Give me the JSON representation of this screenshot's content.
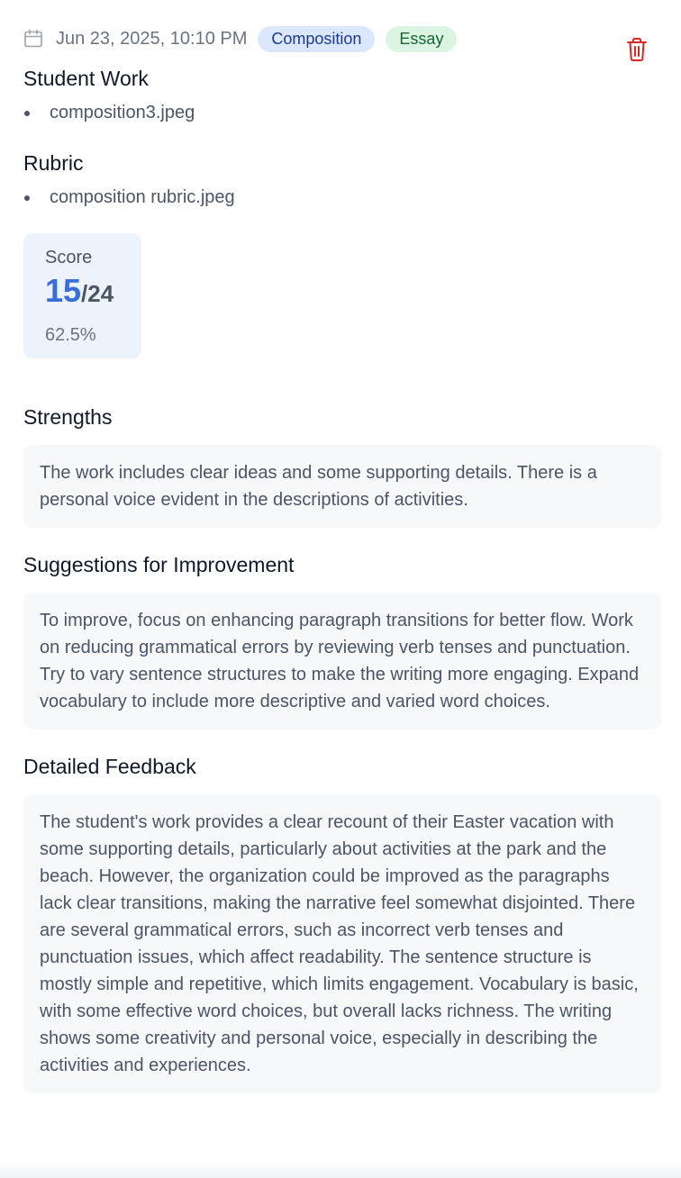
{
  "header": {
    "date": "Jun 23, 2025, 10:10 PM",
    "tags": [
      "Composition",
      "Essay"
    ],
    "icons": {
      "calendar": "calendar-icon",
      "delete": "trash-icon"
    },
    "colors": {
      "delete": "#dc2626",
      "accent": "#3b6fd8"
    }
  },
  "student_work": {
    "title": "Student Work",
    "files": [
      "composition3.jpeg"
    ]
  },
  "rubric": {
    "title": "Rubric",
    "files": [
      "composition rubric.jpeg"
    ]
  },
  "score": {
    "label": "Score",
    "value": "15",
    "total": "/24",
    "percent": "62.5%"
  },
  "strengths": {
    "title": "Strengths",
    "text": "The work includes clear ideas and some supporting details. There is a personal voice evident in the descriptions of activities."
  },
  "suggestions": {
    "title": "Suggestions for Improvement",
    "text": "To improve, focus on enhancing paragraph transitions for better flow. Work on reducing grammatical errors by reviewing verb tenses and punctuation. Try to vary sentence structures to make the writing more engaging. Expand vocabulary to include more descriptive and varied word choices."
  },
  "detailed": {
    "title": "Detailed Feedback",
    "text": "The student's work provides a clear recount of their Easter vacation with some supporting details, particularly about activities at the park and the beach. However, the organization could be improved as the paragraphs lack clear transitions, making the narrative feel somewhat disjointed. There are several grammatical errors, such as incorrect verb tenses and punctuation issues, which affect readability. The sentence structure is mostly simple and repetitive, which limits engagement. Vocabulary is basic, with some effective word choices, but overall lacks richness. The writing shows some creativity and personal voice, especially in describing the activities and experiences."
  }
}
